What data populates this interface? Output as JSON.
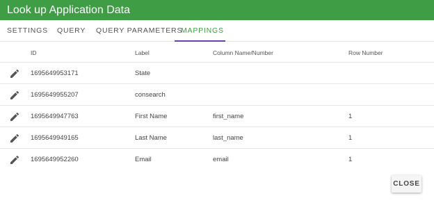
{
  "dialog": {
    "title": "Look up Application Data",
    "accent_color": "#3f9e45",
    "tab_indicator_color": "#6a3fb5"
  },
  "tabs": [
    {
      "label": "SETTINGS",
      "active": false
    },
    {
      "label": "QUERY",
      "active": false
    },
    {
      "label": "QUERY PARAMETERS",
      "active": false
    },
    {
      "label": "MAPPINGS",
      "active": true
    }
  ],
  "table": {
    "columns": [
      "ID",
      "Label",
      "Column Name/Number",
      "Row Number"
    ],
    "rows": [
      {
        "id": "1695649953171",
        "label": "State",
        "column": "",
        "row": ""
      },
      {
        "id": "1695649955207",
        "label": "consearch",
        "column": "",
        "row": ""
      },
      {
        "id": "1695649947763",
        "label": "First Name",
        "column": "first_name",
        "row": "1"
      },
      {
        "id": "1695649949165",
        "label": "Last Name",
        "column": "last_name",
        "row": "1"
      },
      {
        "id": "1695649952260",
        "label": "Email",
        "column": "email",
        "row": "1"
      }
    ],
    "row_action_icon": "pencil-edit-icon"
  },
  "footer": {
    "close_label": "CLOSE"
  }
}
